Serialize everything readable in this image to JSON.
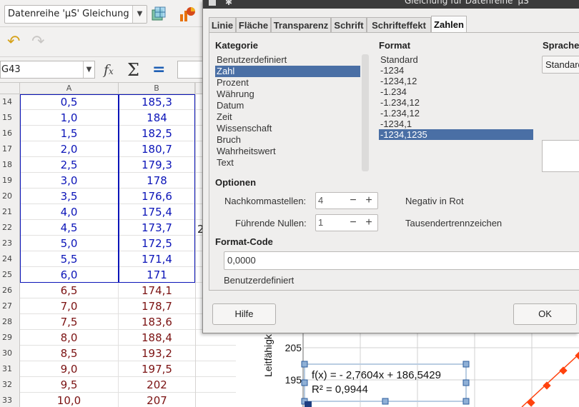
{
  "toolbar": {
    "series_select_value": "Datenreihe 'µS'  Gleichung (Ab",
    "icons": [
      "undo-icon",
      "redo-icon",
      "chart-type-icon",
      "format-selection-icon"
    ]
  },
  "formulabar": {
    "namebox_value": "G43",
    "icons": [
      "function-wizard-icon",
      "sum-icon",
      "formula-icon"
    ]
  },
  "sheet": {
    "columns": [
      "A",
      "B"
    ],
    "rows": [
      {
        "num": "14",
        "a": "0,5",
        "b": "185,3"
      },
      {
        "num": "15",
        "a": "1,0",
        "b": "184"
      },
      {
        "num": "16",
        "a": "1,5",
        "b": "182,5"
      },
      {
        "num": "17",
        "a": "2,0",
        "b": "180,7"
      },
      {
        "num": "18",
        "a": "2,5",
        "b": "179,3"
      },
      {
        "num": "19",
        "a": "3,0",
        "b": "178"
      },
      {
        "num": "20",
        "a": "3,5",
        "b": "176,6"
      },
      {
        "num": "21",
        "a": "4,0",
        "b": "175,4"
      },
      {
        "num": "22",
        "a": "4,5",
        "b": "173,7"
      },
      {
        "num": "23",
        "a": "5,0",
        "b": "172,5"
      },
      {
        "num": "24",
        "a": "5,5",
        "b": "171,4"
      },
      {
        "num": "25",
        "a": "6,0",
        "b": "171"
      },
      {
        "num": "26",
        "a": "6,5",
        "b": "174,1"
      },
      {
        "num": "27",
        "a": "7,0",
        "b": "178,7"
      },
      {
        "num": "28",
        "a": "7,5",
        "b": "183,6"
      },
      {
        "num": "29",
        "a": "8,0",
        "b": "188,4"
      },
      {
        "num": "30",
        "a": "8,5",
        "b": "193,2"
      },
      {
        "num": "31",
        "a": "9,0",
        "b": "197,5"
      },
      {
        "num": "32",
        "a": "9,5",
        "b": "202"
      },
      {
        "num": "33",
        "a": "10,0",
        "b": "207"
      }
    ],
    "stray_char": "2",
    "colors": {
      "selected_text": "#0b14b8",
      "other_text": "#7b1212"
    }
  },
  "chart": {
    "y_axis_label": "Leitfähigk",
    "y_ticks": [
      "205",
      "195"
    ],
    "equation_line1": "f(x) =  - 2,7604x + 186,5429",
    "equation_line2": "R² = 0,9944",
    "series_color": "#ff420e"
  },
  "dialog": {
    "title": "Gleichung für Datenreihe 'µS'",
    "tabs": [
      "Linie",
      "Fläche",
      "Transparenz",
      "Schrift",
      "Schrifteffekt",
      "Zahlen"
    ],
    "active_tab": "Zahlen",
    "kategorie_label": "Kategorie",
    "kategorien": [
      "Benutzerdefiniert",
      "Zahl",
      "Prozent",
      "Währung",
      "Datum",
      "Zeit",
      "Wissenschaft",
      "Bruch",
      "Wahrheitswert",
      "Text"
    ],
    "kategorie_selected": "Zahl",
    "format_label": "Format",
    "formate": [
      "Standard",
      "-1234",
      "-1234,12",
      "-1.234",
      "-1.234,12",
      "-1.234,12",
      "-1234,1",
      "-1234,1235"
    ],
    "format_selected": "-1234,1235",
    "sprache_label": "Sprache",
    "sprache_value": "Standard",
    "optionen_label": "Optionen",
    "nachkommastellen_label": "Nachkommastellen:",
    "nachkommastellen_value": "4",
    "fuehrende_nullen_label": "Führende Nullen:",
    "fuehrende_nullen_value": "1",
    "negativ_rot_label": "Negativ in Rot",
    "tausender_label": "Tausendertrennzeichen",
    "format_code_label": "Format-Code",
    "format_code_value": "0,0000",
    "format_code_desc": "Benutzerdefiniert",
    "hilfe_label": "Hilfe",
    "ok_label": "OK",
    "selection_color": "#4a6fa5"
  }
}
